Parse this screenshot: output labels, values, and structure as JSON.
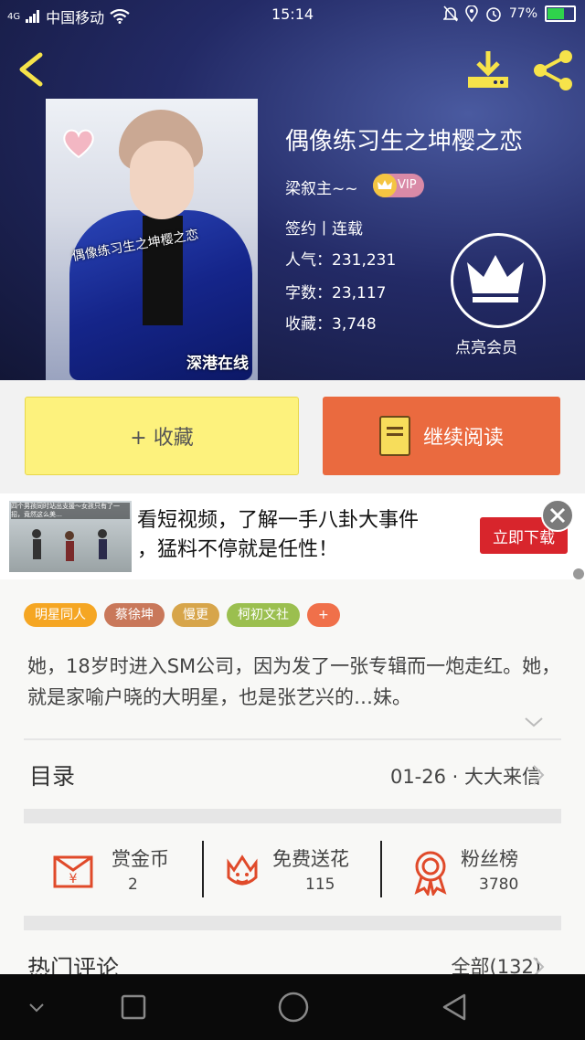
{
  "status": {
    "carrier": "中国移动",
    "network": "4G",
    "time": "15:14",
    "battery": "77%",
    "battery_level": 0.77
  },
  "cover": {
    "overlay_title": "偶像练习生之坤樱之恋",
    "brand": "深港在线"
  },
  "book": {
    "title": "偶像练习生之坤樱之恋",
    "author": "梁叙主~~",
    "vip": "VIP",
    "sign_status": "签约丨连载",
    "popularity": "人气：231,231",
    "words": "字数：23,117",
    "favorites": "收藏：3,748"
  },
  "member": {
    "label": "点亮会员"
  },
  "actions": {
    "favorite": "+ 收藏",
    "continue_read": "继续阅读"
  },
  "ad": {
    "line1": "看短视频，了解一手八卦大事件",
    "line2": "，猛料不停就是任性！",
    "button": "立即下载",
    "thumb_caption": "四个男孩同时站出支援～女孩只有了一招，竟然这么美…"
  },
  "tags": [
    {
      "label": "明星同人",
      "color": "#f5a623"
    },
    {
      "label": "蔡徐坤",
      "color": "#c9785a"
    },
    {
      "label": "慢更",
      "color": "#d7a54a"
    },
    {
      "label": "柯初文社",
      "color": "#9bbf4f"
    },
    {
      "label": "+",
      "color": "#f0704a"
    }
  ],
  "description": "她，18岁时进入SM公司，因为发了一张专辑而一炮走红。她，就是家喻户晓的大明星，也是张艺兴的…妹。",
  "toc": {
    "label": "目录",
    "latest": "01-26 · 大大来信"
  },
  "stats": [
    {
      "label": "赏金币",
      "value": "2"
    },
    {
      "label": "免费送花",
      "value": "115"
    },
    {
      "label": "粉丝榜",
      "value": "3780"
    }
  ],
  "comments": {
    "label": "热门评论",
    "all": "全部(132)"
  },
  "colors": {
    "accent_orange": "#ea6a3f",
    "accent_yellow": "#fdf27d",
    "icon_red": "#e04a2a",
    "header_icon": "#f6e34a"
  }
}
